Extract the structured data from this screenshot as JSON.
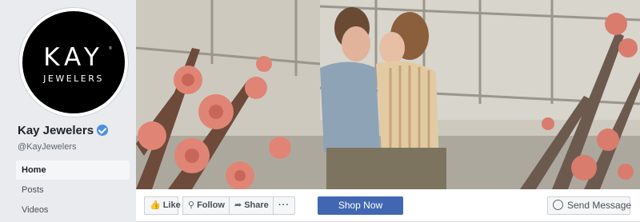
{
  "profile": {
    "logo_line1": "KAY",
    "logo_reg": "®",
    "logo_line2": "JEWELERS",
    "name": "Kay Jewelers",
    "handle": "@KayJewelers",
    "verified_icon": "verified-badge-icon"
  },
  "nav": {
    "items": [
      {
        "label": "Home",
        "active": true
      },
      {
        "label": "Posts",
        "active": false
      },
      {
        "label": "Videos",
        "active": false
      }
    ]
  },
  "actions": {
    "like_label": "Like",
    "follow_label": "Follow",
    "share_label": "Share",
    "more_label": "···",
    "shop_label": "Shop Now",
    "message_label": "Send Message"
  },
  "icons": {
    "like": "thumbs-up-icon",
    "follow": "rss-icon",
    "share": "share-arrow-icon",
    "message": "messenger-icon"
  },
  "colors": {
    "brand_blue": "#4267b2",
    "verified": "#4a90e2",
    "background": "#e9ebee"
  }
}
